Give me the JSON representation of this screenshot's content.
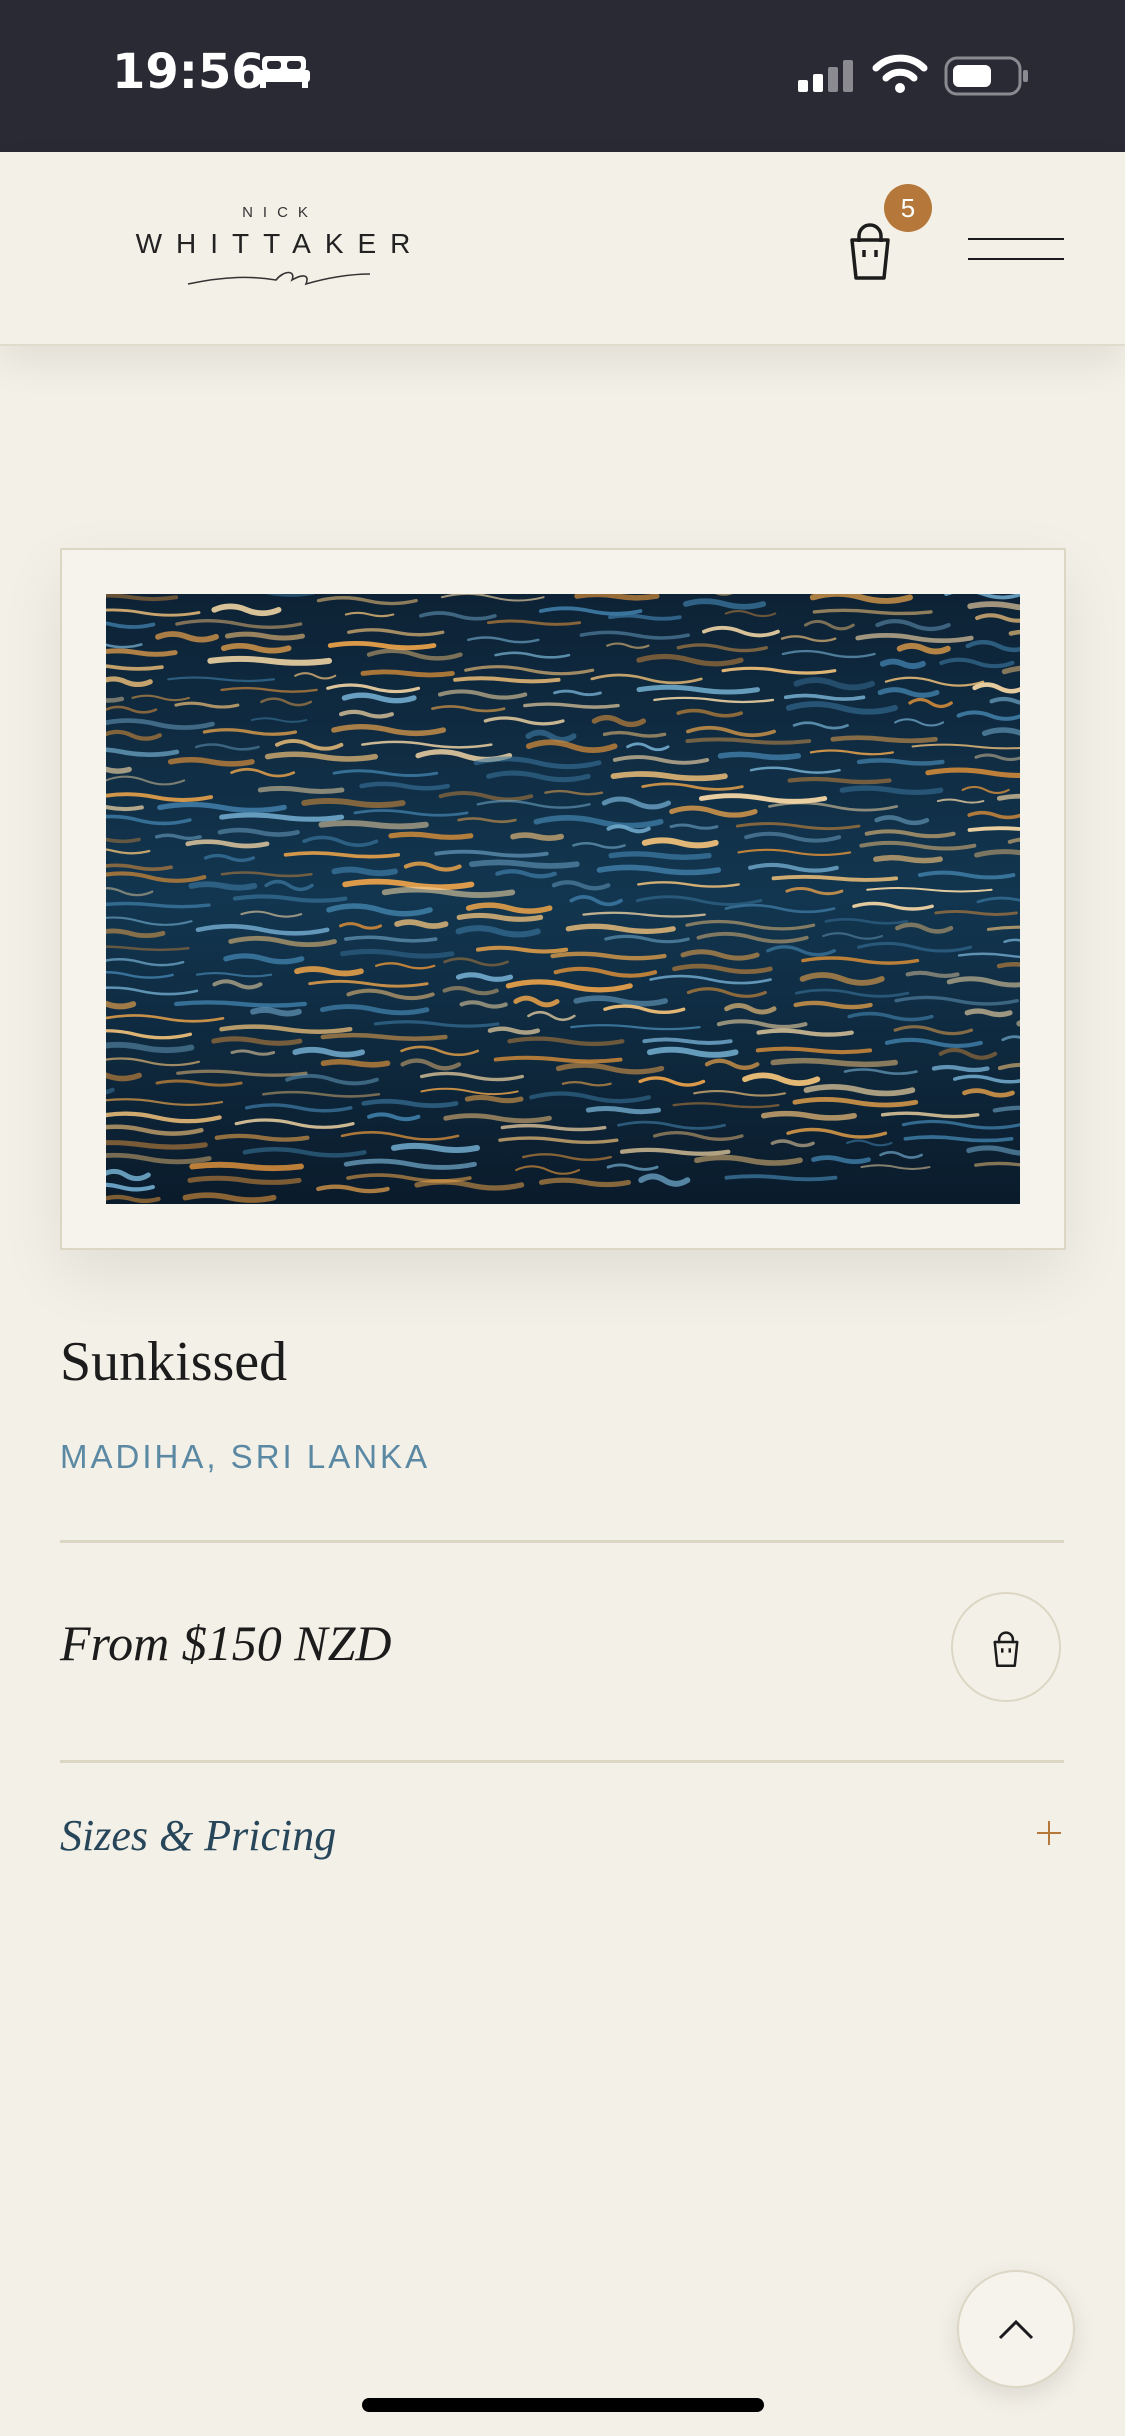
{
  "status_bar": {
    "time": "19:56",
    "icons": [
      "sleep-icon",
      "cellular-signal-icon",
      "wifi-icon",
      "battery-icon"
    ]
  },
  "header": {
    "logo_top": "NICK",
    "logo_main": "WHITTAKER",
    "cart_count": "5",
    "icons": [
      "shopping-bag-icon",
      "menu-icon"
    ]
  },
  "product": {
    "title": "Sunkissed",
    "location": "MADIHA, SRI LANKA",
    "price": "From $150 NZD",
    "sizes_label": "Sizes & Pricing"
  },
  "colors": {
    "background": "#f3f0e7",
    "status_bar": "#2a2a34",
    "accent": "#b5783a",
    "location_text": "#5b89a3",
    "link_text": "#27465a",
    "divider": "#dcd7c4"
  }
}
